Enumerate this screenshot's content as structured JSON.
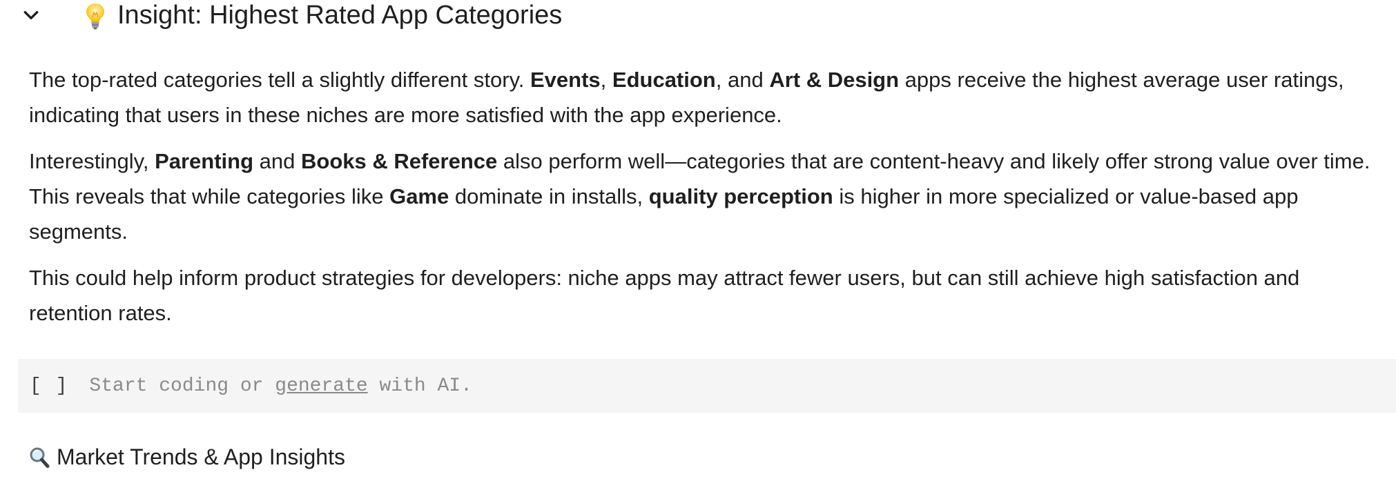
{
  "section_header": {
    "collapse_icon": "chevron-down-icon",
    "emoji_icon": "light-bulb-icon",
    "title": "Insight: Highest Rated App Categories"
  },
  "text_cell": {
    "p1": {
      "t1": "The top-rated categories tell a slightly different story. ",
      "b1": "Events",
      "t2": ", ",
      "b2": "Education",
      "t3": ", and ",
      "b3": "Art & Design",
      "t4": " apps receive the highest average user ratings, indicating that users in these niches are more satisfied with the app experience."
    },
    "p2": {
      "t1": "Interestingly, ",
      "b1": "Parenting",
      "t2": " and ",
      "b2": "Books & Reference",
      "t3": " also perform well—categories that are content-heavy and likely offer strong value over time. This reveals that while categories like ",
      "b3": "Game",
      "t4": " dominate in installs, ",
      "b4": "quality perception",
      "t5": " is higher in more specialized or value-based app segments."
    },
    "p3": {
      "t1": "This could help inform product strategies for developers: niche apps may attract fewer users, but can still achieve high satisfaction and retention rates."
    }
  },
  "code_cell": {
    "run_label": "[ ]",
    "placeholder_prefix": "Start coding or ",
    "placeholder_link": "generate",
    "placeholder_suffix": " with AI."
  },
  "next_section": {
    "emoji_icon": "magnifying-glass-icon",
    "title": "Market Trends & App Insights"
  },
  "colors": {
    "text": "#1f1f1f",
    "code_cell_bg": "#f5f5f5",
    "placeholder": "#8a8a8a"
  }
}
